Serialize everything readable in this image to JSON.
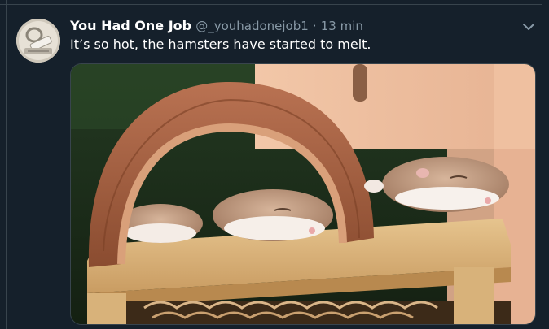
{
  "tweet": {
    "author_name": "You Had One Job",
    "author_handle": "@_youhadonejob1",
    "separator": "·",
    "timestamp": "13 min",
    "text": "It’s so hot, the hamsters have started to melt."
  },
  "icons": {
    "menu": "chevron-down-icon",
    "avatar": "avatar"
  },
  "colors": {
    "background": "#15202b",
    "border": "#38444d",
    "secondary_text": "#8899a6",
    "primary_text": "#ffffff"
  }
}
